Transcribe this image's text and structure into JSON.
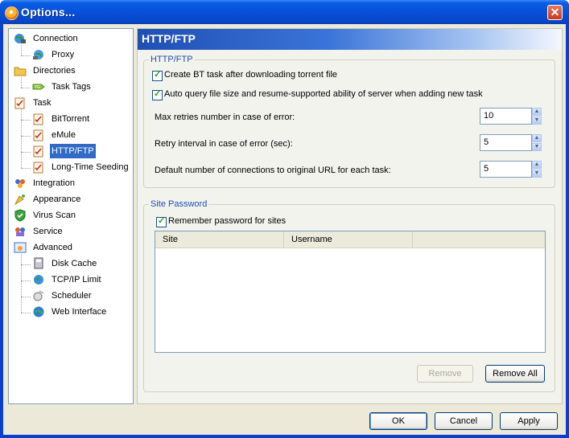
{
  "window": {
    "title": "Options...",
    "close_glyph": "✕"
  },
  "tree": [
    {
      "label": "Connection",
      "icon": "globe-network-icon",
      "level": 0
    },
    {
      "label": "Proxy",
      "icon": "globe-proxy-icon",
      "level": 1
    },
    {
      "label": "Directories",
      "icon": "folder-icon",
      "level": 0
    },
    {
      "label": "Task Tags",
      "icon": "tag-icon",
      "level": 1
    },
    {
      "label": "Task",
      "icon": "task-clipboard-icon",
      "level": 0
    },
    {
      "label": "BitTorrent",
      "icon": "task-clipboard-icon",
      "level": 1
    },
    {
      "label": "eMule",
      "icon": "task-clipboard-icon",
      "level": 1
    },
    {
      "label": "HTTP/FTP",
      "icon": "task-clipboard-icon",
      "level": 1,
      "selected": true
    },
    {
      "label": "Long-Time Seeding",
      "icon": "task-clipboard-icon",
      "level": 1
    },
    {
      "label": "Integration",
      "icon": "integration-icon",
      "level": 0
    },
    {
      "label": "Appearance",
      "icon": "appearance-icon",
      "level": 0
    },
    {
      "label": "Virus Scan",
      "icon": "shield-icon",
      "level": 0
    },
    {
      "label": "Service",
      "icon": "service-icon",
      "level": 0
    },
    {
      "label": "Advanced",
      "icon": "advanced-icon",
      "level": 0
    },
    {
      "label": "Disk Cache",
      "icon": "disk-cache-icon",
      "level": 1
    },
    {
      "label": "TCP/IP Limit",
      "icon": "tcpip-icon",
      "level": 1
    },
    {
      "label": "Scheduler",
      "icon": "scheduler-icon",
      "level": 1
    },
    {
      "label": "Web Interface",
      "icon": "web-globe-icon",
      "level": 1
    }
  ],
  "panel": {
    "title": "HTTP/FTP",
    "group1": {
      "title": "HTTP/FTP",
      "check_create_bt": "Create BT task after downloading torrent file",
      "check_auto_query": "Auto query file size and resume-supported ability of server when adding new task",
      "max_retries_label": "Max retries number in case of error:",
      "max_retries_value": "10",
      "retry_interval_label": "Retry interval in case of error (sec):",
      "retry_interval_value": "5",
      "connections_label": "Default number of connections to original URL for each task:",
      "connections_value": "5"
    },
    "group2": {
      "title": "Site Password",
      "check_remember": "Remember password for sites",
      "columns": [
        "Site",
        "Username"
      ],
      "remove_label": "Remove",
      "remove_all_label": "Remove All"
    }
  },
  "footer": {
    "ok": "OK",
    "cancel": "Cancel",
    "apply": "Apply"
  }
}
